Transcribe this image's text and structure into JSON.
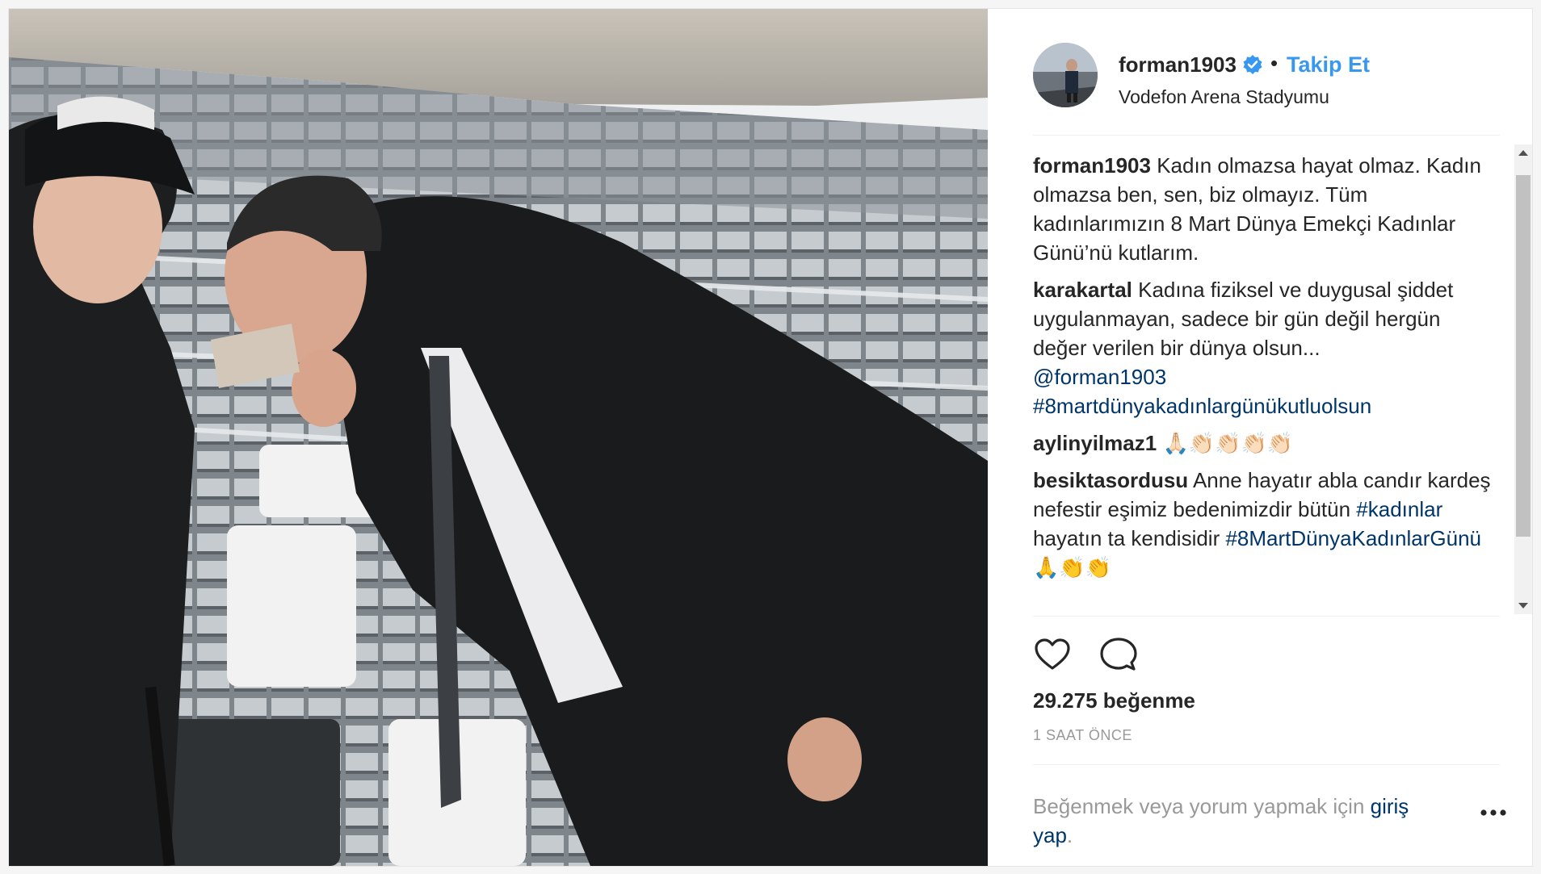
{
  "post": {
    "username": "forman1903",
    "separator": "•",
    "follow_label": "Takip Et",
    "location": "Vodefon Arena Stadyumu"
  },
  "comments": [
    {
      "user": "forman1903",
      "parts": [
        {
          "text": "Kadın olmazsa hayat olmaz. Kadın olmazsa ben, sen, biz olmayız. Tüm kadınlarımızın 8 Mart Dünya Emekçi Kadınlar Günü’nü kutlarım."
        }
      ]
    },
    {
      "user": "karakartal",
      "parts": [
        {
          "text": "Kadına fiziksel ve duygusal şiddet uygulanmayan, sadece bir gün değil hergün değer verilen bir dünya olsun..."
        },
        {
          "text": "@forman1903",
          "link": true,
          "break_before": true
        },
        {
          "text": "#8martdünyakadınlargünükutluolsun",
          "link": true,
          "break_before": true
        }
      ]
    },
    {
      "user": "aylinyilmaz1",
      "parts": [
        {
          "text": "🙏🏻👏🏻👏🏻👏🏻👏🏻"
        }
      ]
    },
    {
      "user": "besiktasordusu",
      "parts": [
        {
          "text": "Anne hayatır abla candır kardeş nefestir eşimiz bedenimizdir bütün "
        },
        {
          "text": "#kadınlar",
          "link": true
        },
        {
          "text": " hayatın ta kendisidir "
        },
        {
          "text": "#8MartDünyaKadınlarGünü",
          "link": true
        },
        {
          "text": " 🙏👏👏"
        }
      ]
    }
  ],
  "stats": {
    "likes": "29.275 beğenme",
    "time": "1 SAAT ÖNCE"
  },
  "login": {
    "prefix": "Beğenmek veya yorum yapmak için ",
    "link": "giriş yap",
    "suffix": "."
  },
  "icons": {
    "verified": "verified-badge-icon",
    "like": "heart-icon",
    "comment": "speech-bubble-icon",
    "more": "more-options-icon",
    "scroll_up": "scroll-up-arrow-icon",
    "scroll_down": "scroll-down-arrow-icon"
  },
  "colors": {
    "accent": "#3897f0",
    "link": "#003569",
    "text": "#262626",
    "muted": "#999999"
  }
}
